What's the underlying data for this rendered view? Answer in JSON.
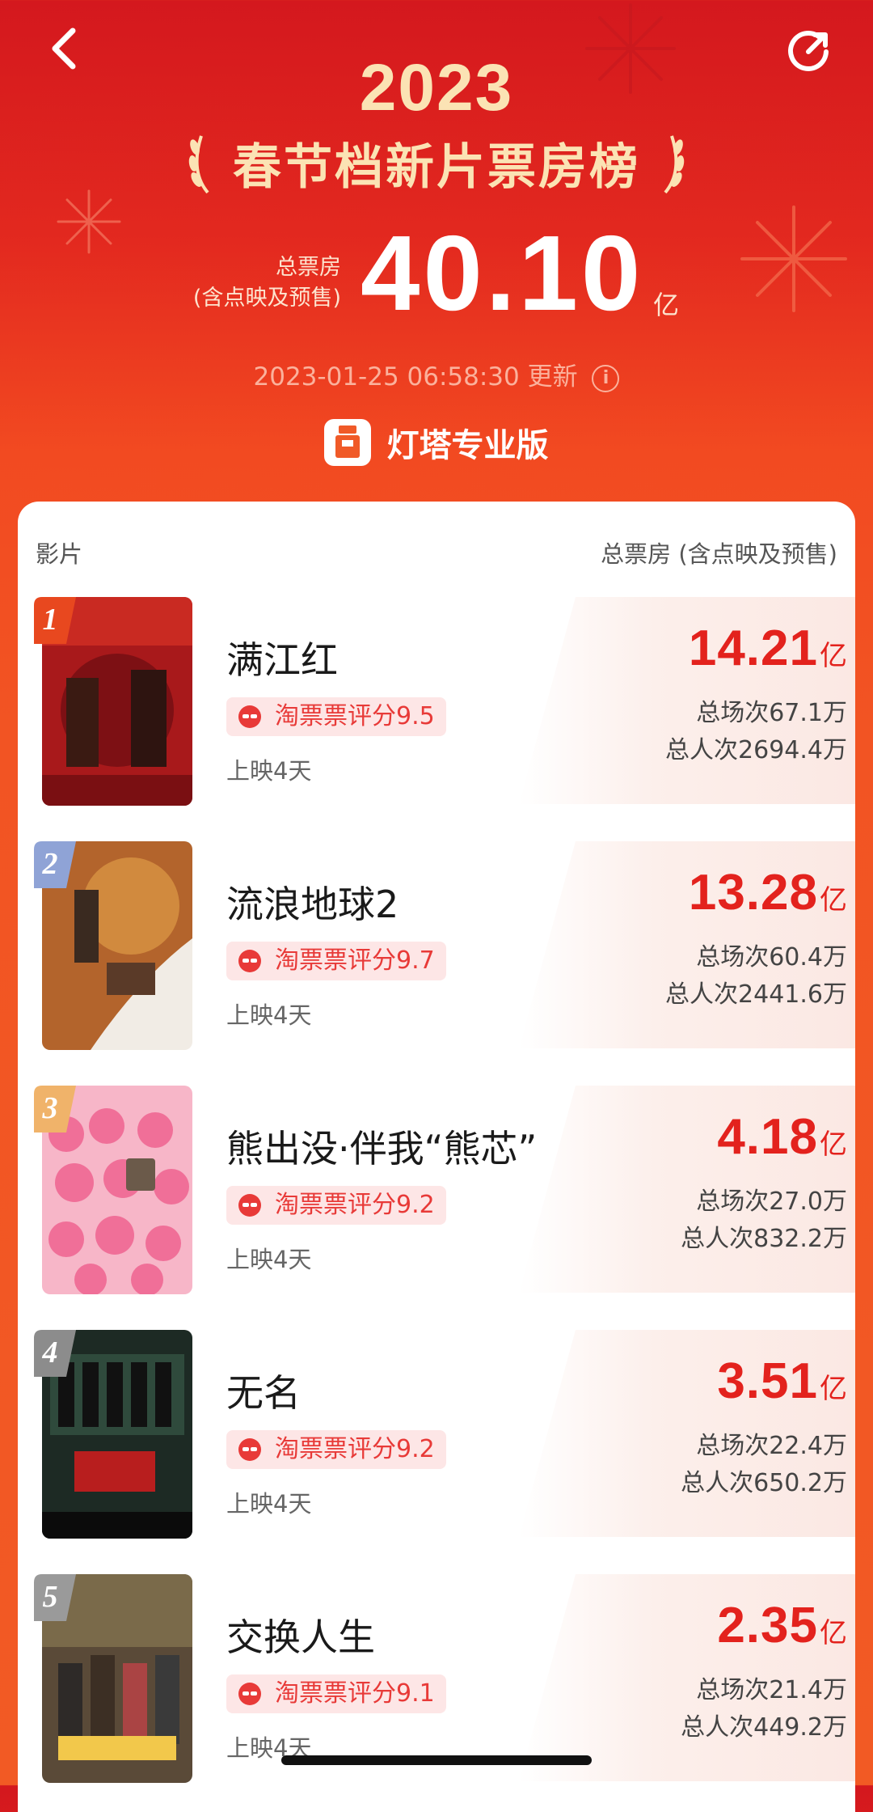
{
  "header": {
    "year": "2023",
    "title": "春节档新片票房榜",
    "total_label_line1": "总票房",
    "total_label_line2": "(含点映及预售)",
    "total_value": "40.10",
    "total_unit": "亿",
    "update_time": "2023-01-25 06:58:30 更新",
    "brand_name": "灯塔专业版",
    "back_icon": "chevron-left-icon",
    "share_icon": "share-icon",
    "info_icon": "info-icon"
  },
  "table": {
    "col_left": "影片",
    "col_right": "总票房 (含点映及预售)"
  },
  "movies": [
    {
      "rank": "1",
      "title": "满江红",
      "rating": "淘票票评分9.5",
      "days": "上映4天",
      "box_office": "14.21",
      "unit": "亿",
      "screenings": "总场次67.1万",
      "admissions": "总人次2694.4万"
    },
    {
      "rank": "2",
      "title": "流浪地球2",
      "rating": "淘票票评分9.7",
      "days": "上映4天",
      "box_office": "13.28",
      "unit": "亿",
      "screenings": "总场次60.4万",
      "admissions": "总人次2441.6万"
    },
    {
      "rank": "3",
      "title": "熊出没·伴我“熊芯”",
      "rating": "淘票票评分9.2",
      "days": "上映4天",
      "box_office": "4.18",
      "unit": "亿",
      "screenings": "总场次27.0万",
      "admissions": "总人次832.2万"
    },
    {
      "rank": "4",
      "title": "无名",
      "rating": "淘票票评分9.2",
      "days": "上映4天",
      "box_office": "3.51",
      "unit": "亿",
      "screenings": "总场次22.4万",
      "admissions": "总人次650.2万"
    },
    {
      "rank": "5",
      "title": "交换人生",
      "rating": "淘票票评分9.1",
      "days": "上映4天",
      "box_office": "2.35",
      "unit": "亿",
      "screenings": "总场次21.4万",
      "admissions": "总人次449.2万"
    }
  ],
  "colors": {
    "accent_red": "#e3221d",
    "gold_text": "#fbe3b4",
    "rank_1": "#e8481f",
    "rank_2": "#8fa3d6",
    "rank_3": "#f0b36a",
    "rank_4": "#8c8c8c",
    "rank_5": "#9a9a9a"
  }
}
